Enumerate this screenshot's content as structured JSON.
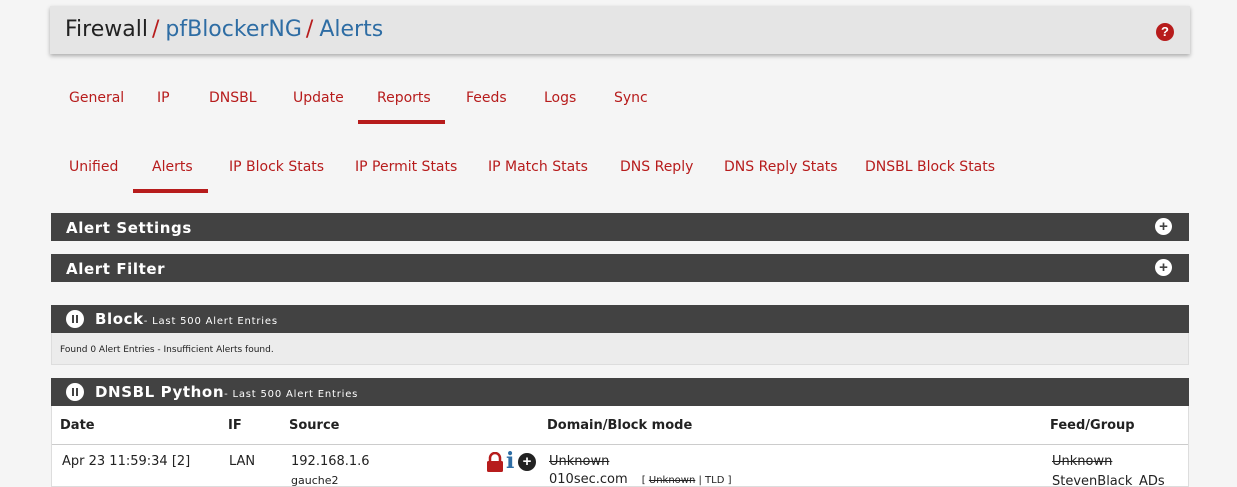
{
  "breadcrumb": {
    "part1": "Firewall",
    "sep": "/",
    "part2": "pfBlockerNG",
    "part3": "Alerts"
  },
  "help": "?",
  "main_tabs": [
    "General",
    "IP",
    "DNSBL",
    "Update",
    "Reports",
    "Feeds",
    "Logs",
    "Sync"
  ],
  "sub_tabs": [
    "Unified",
    "Alerts",
    "IP Block Stats",
    "IP Permit Stats",
    "IP Match Stats",
    "DNS Reply",
    "DNS Reply Stats",
    "DNSBL Block Stats"
  ],
  "active_main_tab": "Reports",
  "active_sub_tab": "Alerts",
  "panels": {
    "alert_settings": "Alert Settings",
    "alert_filter": "Alert Filter",
    "block_title": "Block",
    "block_sub": "- Last 500 Alert Entries",
    "block_empty": "Found 0 Alert Entries - Insufficient Alerts found.",
    "dnsbl_title": "DNSBL Python",
    "dnsbl_sub": "- Last 500 Alert Entries"
  },
  "table": {
    "headers": {
      "date": "Date",
      "if": "IF",
      "source": "Source",
      "domain": "Domain/Block mode",
      "feed": "Feed/Group"
    },
    "row": {
      "date": "Apr 23 11:59:34 [2]",
      "if": "LAN",
      "source_ip": "192.168.1.6",
      "source_host": "gauche2",
      "domain_top": "Unknown",
      "domain": "010sec.com",
      "mode_open": "[",
      "mode_unknown": "Unknown",
      "mode_tld": "| TLD ]",
      "feed_top": "Unknown",
      "feed": "StevenBlack_ADs"
    }
  },
  "plus": "+",
  "info": "i",
  "colors": {
    "accent": "#b71c1c",
    "link": "#2e6da4",
    "panel": "#424242"
  }
}
